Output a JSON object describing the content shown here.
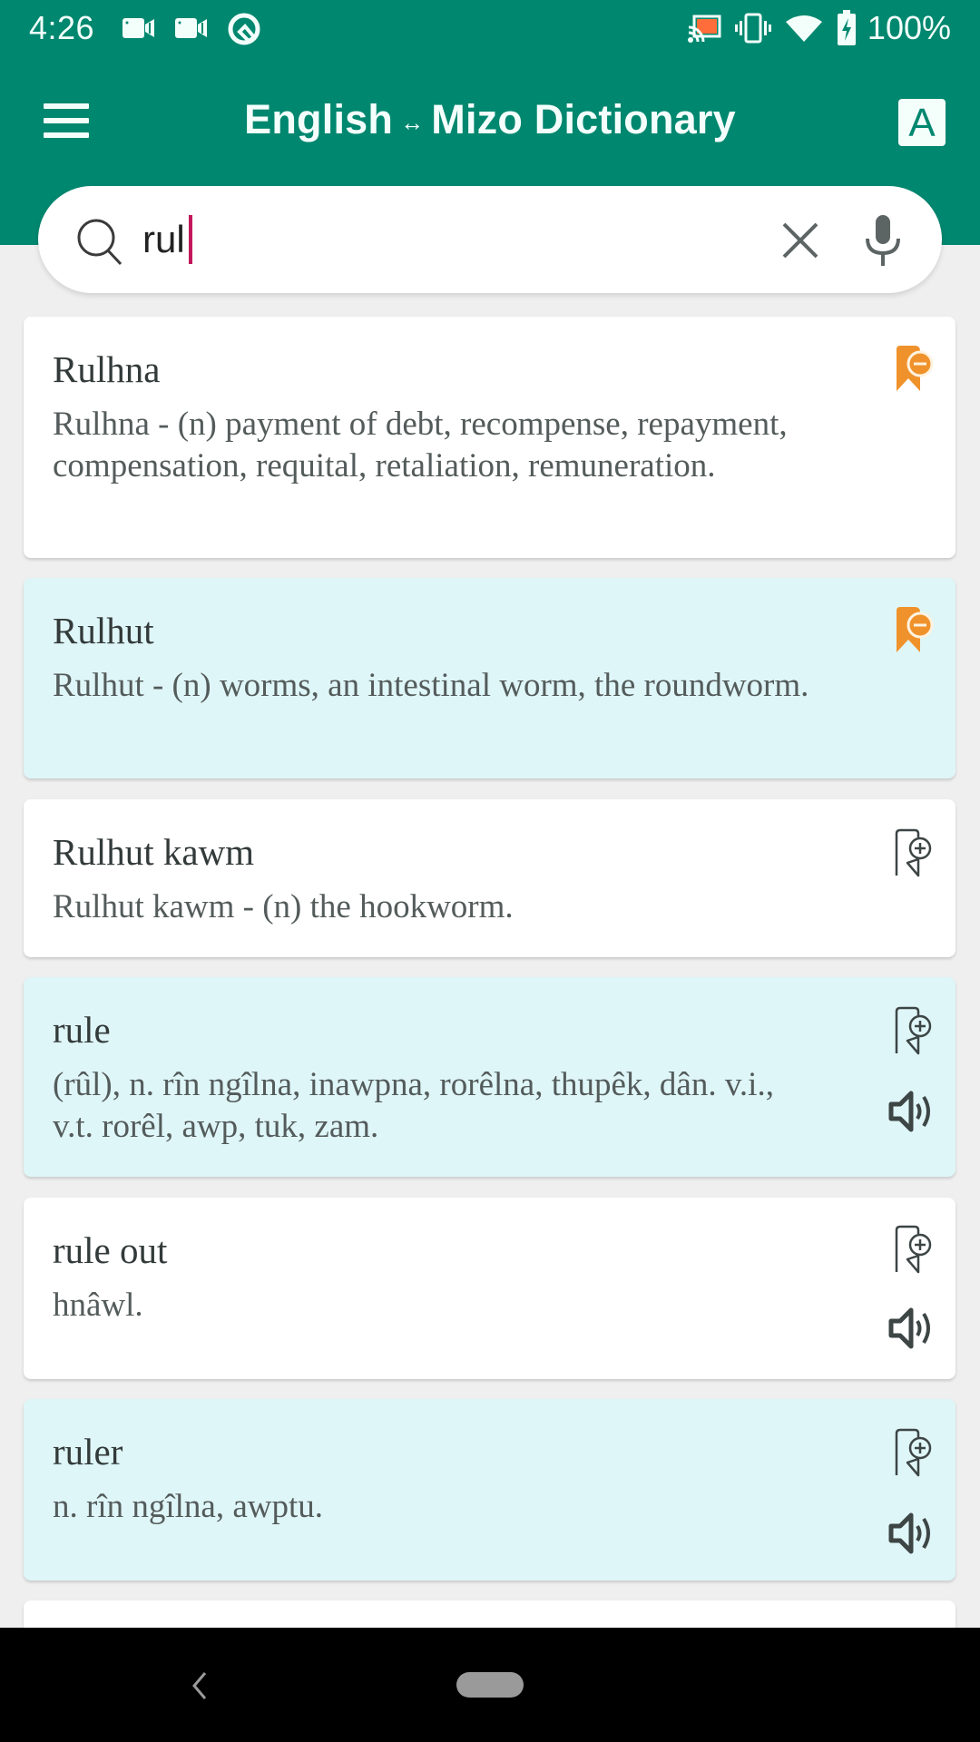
{
  "status_bar": {
    "time": "4:26",
    "left_icons": [
      "video-camera-icon",
      "video-camera-icon",
      "q-logo-icon"
    ],
    "right_icons": [
      "cast-icon",
      "vibrate-icon",
      "wifi-icon",
      "battery-charging-icon"
    ],
    "battery": "100%",
    "cast_accent": "#ff6d3a"
  },
  "header": {
    "menu_icon": "hamburger-menu-icon",
    "title_left": "English",
    "title_arrow": "↔",
    "title_right": "Mizo Dictionary",
    "font_button_label": "A",
    "color": "#00876f"
  },
  "search": {
    "value": "rul",
    "placeholder": "",
    "search_icon": "search-icon",
    "clear_icon": "close-icon",
    "mic_icon": "microphone-icon",
    "caret_color": "#c2185b"
  },
  "results": [
    {
      "word": "Rulhna",
      "definition": "Rulhna - (n) payment of debt, recompense, repayment, compensation, requital, retaliation, remuneration.",
      "bookmarked": true,
      "has_audio": false,
      "bg": "white"
    },
    {
      "word": "Rulhut",
      "definition": "Rulhut - (n) worms, an intestinal worm, the roundworm.",
      "bookmarked": true,
      "has_audio": false,
      "bg": "cyan"
    },
    {
      "word": "Rulhut kawm",
      "definition": "Rulhut kawm - (n) the hookworm.",
      "bookmarked": false,
      "has_audio": false,
      "bg": "white"
    },
    {
      "word": "rule",
      "definition": "(rûl), n. rîn ngîlna, inawpna, rorêlna, thupêk, dân. v.i., v.t. rorêl, awp, tuk, zam.",
      "bookmarked": false,
      "has_audio": true,
      "bg": "cyan"
    },
    {
      "word": "rule out",
      "definition": "hnâwl.",
      "bookmarked": false,
      "has_audio": true,
      "bg": "white"
    },
    {
      "word": "ruler",
      "definition": "n. rîn ngîlna, awptu.",
      "bookmarked": false,
      "has_audio": true,
      "bg": "cyan"
    },
    {
      "word": "",
      "definition": "",
      "bookmarked": false,
      "has_audio": false,
      "bg": "white"
    }
  ],
  "colors": {
    "bookmarked": "#f0922b",
    "icon_gray": "#3d4545",
    "card_alt": "#dff6f8"
  },
  "nav_bar": {
    "back_icon": "back-chevron-icon",
    "home_icon": "home-pill-icon"
  }
}
